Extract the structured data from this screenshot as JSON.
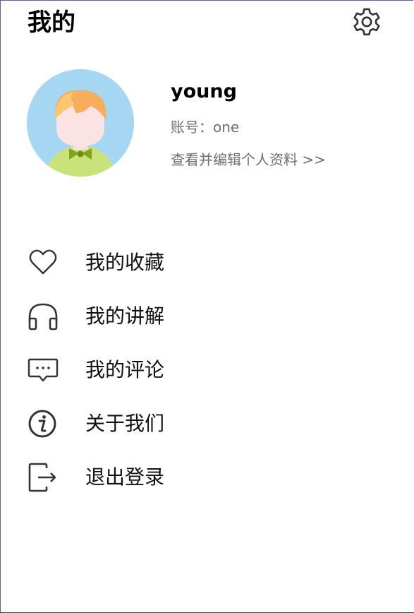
{
  "header": {
    "title": "我的",
    "settings_icon": "gear-icon"
  },
  "profile": {
    "avatar_icon": "cartoon-boy-avatar",
    "username": "young",
    "account": "账号：one",
    "edit_link": "查看并编辑个人资料 >>"
  },
  "menu": {
    "items": [
      {
        "label": "我的收藏",
        "icon": "heart-icon"
      },
      {
        "label": "我的讲解",
        "icon": "headphones-icon"
      },
      {
        "label": "我的评论",
        "icon": "comment-icon"
      },
      {
        "label": "关于我们",
        "icon": "info-icon"
      },
      {
        "label": "退出登录",
        "icon": "logout-icon"
      }
    ]
  },
  "colors": {
    "avatar_bg": "#a5d7f3",
    "secondary_text": "#6e6e6e",
    "icon_stroke": "#333333"
  }
}
